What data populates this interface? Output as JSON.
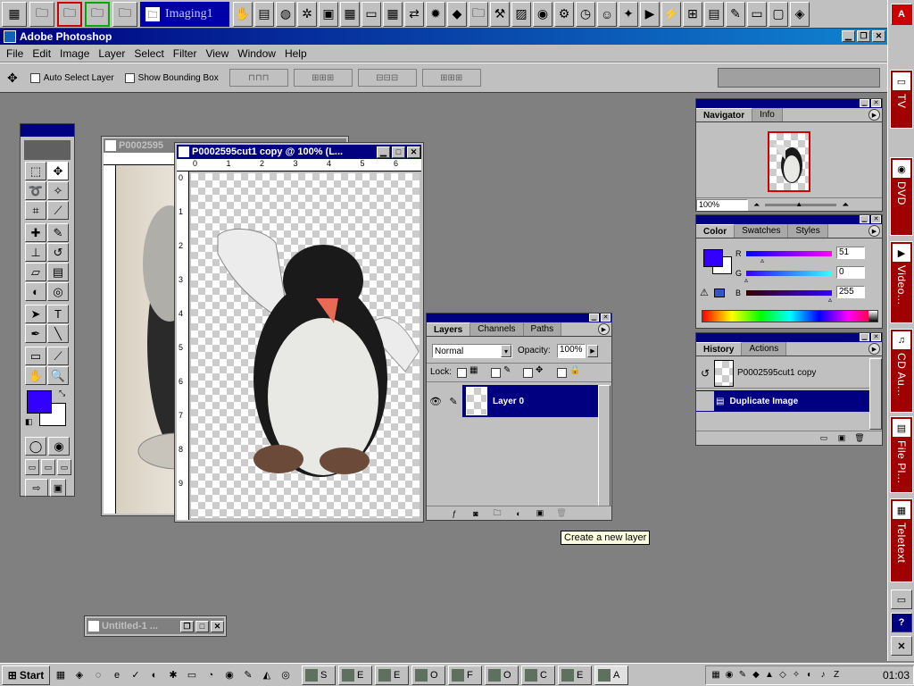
{
  "launcher": {
    "label": "Imaging1",
    "icons": [
      "app-icon",
      "folder-icon",
      "folder-icon",
      "folder-icon",
      "folder-icon"
    ],
    "right_icons": [
      "hand-icon",
      "scanner-icon",
      "globe-icon",
      "compass-icon",
      "display-icon",
      "chip-icon",
      "monitor-icon",
      "grid-icon",
      "arrows-icon",
      "bug-icon",
      "diamond-icon",
      "folder-icon",
      "tool-icon",
      "image-icon",
      "disk-icon",
      "gear-icon",
      "clock-icon",
      "smiley-icon",
      "star-icon",
      "media-icon",
      "flash-icon",
      "network-icon",
      "sheet-icon",
      "pen-icon",
      "window-icon",
      "box-icon",
      "shield-icon"
    ]
  },
  "rightbar": {
    "tabs": [
      {
        "label": "TV"
      },
      {
        "label": "DVD"
      },
      {
        "label": "Video..."
      },
      {
        "label": "CD Au..."
      },
      {
        "label": "File Pl..."
      },
      {
        "label": "Teletext"
      }
    ]
  },
  "app": {
    "title": "Adobe Photoshop",
    "menus": [
      "File",
      "Edit",
      "Image",
      "Layer",
      "Select",
      "Filter",
      "View",
      "Window",
      "Help"
    ]
  },
  "options": {
    "auto_select": "Auto Select Layer",
    "show_bbox": "Show Bounding Box"
  },
  "docs": {
    "back_title": "P0002595",
    "front_title": "P0002595cut1 copy @ 100% (L...",
    "ruler_marks": [
      "0",
      "1",
      "2",
      "3",
      "4",
      "5",
      "6"
    ],
    "minimized_title": "Untitled-1 ..."
  },
  "navigator": {
    "tabs": [
      "Navigator",
      "Info"
    ],
    "zoom": "100%"
  },
  "color": {
    "tabs": [
      "Color",
      "Swatches",
      "Styles"
    ],
    "r_label": "R",
    "r": "51",
    "g_label": "G",
    "g": "0",
    "b_label": "B",
    "b": "255",
    "fg": "#3300ff"
  },
  "history": {
    "tabs": [
      "History",
      "Actions"
    ],
    "snapshot": "P0002595cut1 copy",
    "step": "Duplicate Image"
  },
  "layers": {
    "tabs": [
      "Layers",
      "Channels",
      "Paths"
    ],
    "blend": "Normal",
    "opacity_label": "Opacity:",
    "opacity": "100%",
    "lock_label": "Lock:",
    "layer_name": "Layer 0"
  },
  "tooltip": "Create a new layer",
  "taskbar": {
    "start": "Start",
    "items": [
      "S",
      "E",
      "E",
      "O",
      "F",
      "O",
      "C",
      "E",
      "A"
    ],
    "clock": "01:03"
  }
}
